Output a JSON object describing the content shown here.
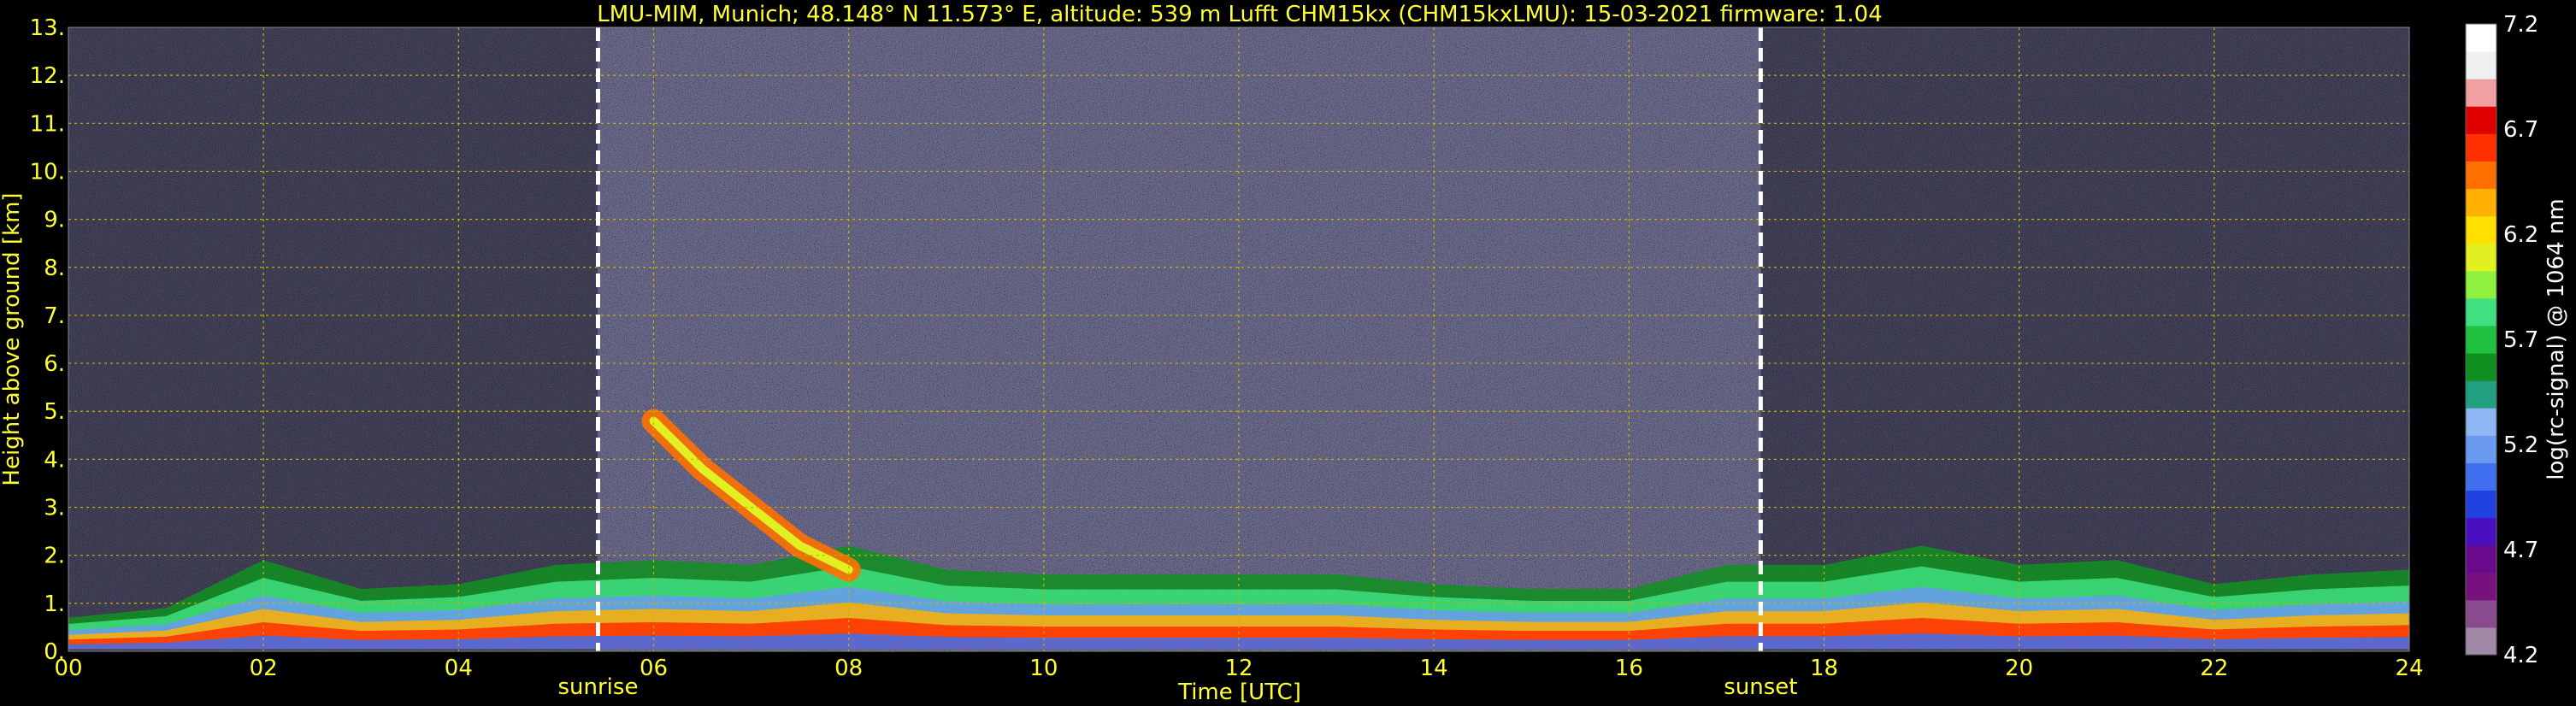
{
  "chart_data": {
    "type": "heatmap",
    "title": "LMU-MIM, Munich; 48.148° N 11.573° E, altitude: 539 m    Lufft CHM15kx (CHM15kxLMU): 15-03-2021    firmware: 1.04",
    "xlabel": "Time [UTC]",
    "ylabel": "Height above ground [km]",
    "colorbar_label": "log(rc-signal) @ 1064 nm",
    "xlim": [
      0,
      24
    ],
    "ylim": [
      0,
      13
    ],
    "x_ticks": [
      "00",
      "02",
      "04",
      "06",
      "08",
      "10",
      "12",
      "14",
      "16",
      "18",
      "20",
      "22",
      "24"
    ],
    "y_ticks": [
      "0.",
      "1.",
      "2.",
      "3.",
      "4.",
      "5.",
      "6.",
      "7.",
      "8.",
      "9.",
      "10.",
      "11.",
      "12.",
      "13."
    ],
    "colorbar_ticks": [
      "4.2",
      "4.7",
      "5.2",
      "5.7",
      "6.2",
      "6.7",
      "7.2"
    ],
    "colorbar_range": [
      4.2,
      7.2
    ],
    "grid": true,
    "annotations": [
      {
        "label": "sunrise",
        "x": 5.43
      },
      {
        "label": "sunset",
        "x": 17.35
      }
    ],
    "colormap": [
      "#a08aa8",
      "#8a4a8e",
      "#76117e",
      "#6a0a8e",
      "#4a10c0",
      "#2040e0",
      "#4070f0",
      "#6a9af0",
      "#8fb6f5",
      "#20a080",
      "#109020",
      "#20c040",
      "#40e080",
      "#90f040",
      "#e0f020",
      "#ffe000",
      "#ffb000",
      "#ff7000",
      "#ff3000",
      "#e00000",
      "#f0a0a0",
      "#f0f0f0",
      "#ffffff"
    ],
    "layers": {
      "boundary_layer": [
        {
          "x": 0.0,
          "top": 0.7,
          "bottom": 0.05
        },
        {
          "x": 1.0,
          "top": 0.9,
          "bottom": 0.05
        },
        {
          "x": 2.0,
          "top": 1.9,
          "bottom": 0.05
        },
        {
          "x": 3.0,
          "top": 1.3,
          "bottom": 0.05
        },
        {
          "x": 4.0,
          "top": 1.4,
          "bottom": 0.05
        },
        {
          "x": 5.0,
          "top": 1.8,
          "bottom": 0.05
        },
        {
          "x": 6.0,
          "top": 1.9,
          "bottom": 0.05
        },
        {
          "x": 7.0,
          "top": 1.8,
          "bottom": 0.05
        },
        {
          "x": 8.0,
          "top": 2.2,
          "bottom": 0.05
        },
        {
          "x": 9.0,
          "top": 1.7,
          "bottom": 0.05
        },
        {
          "x": 10.0,
          "top": 1.6,
          "bottom": 0.05
        },
        {
          "x": 11.0,
          "top": 1.6,
          "bottom": 0.05
        },
        {
          "x": 12.0,
          "top": 1.6,
          "bottom": 0.05
        },
        {
          "x": 13.0,
          "top": 1.6,
          "bottom": 0.05
        },
        {
          "x": 14.0,
          "top": 1.4,
          "bottom": 0.05
        },
        {
          "x": 15.0,
          "top": 1.3,
          "bottom": 0.05
        },
        {
          "x": 16.0,
          "top": 1.3,
          "bottom": 0.05
        },
        {
          "x": 17.0,
          "top": 1.8,
          "bottom": 0.05
        },
        {
          "x": 18.0,
          "top": 1.8,
          "bottom": 0.05
        },
        {
          "x": 19.0,
          "top": 2.2,
          "bottom": 0.05
        },
        {
          "x": 20.0,
          "top": 1.8,
          "bottom": 0.05
        },
        {
          "x": 21.0,
          "top": 1.9,
          "bottom": 0.05
        },
        {
          "x": 22.0,
          "top": 1.4,
          "bottom": 0.05
        },
        {
          "x": 23.0,
          "top": 1.6,
          "bottom": 0.05
        },
        {
          "x": 24.0,
          "top": 1.7,
          "bottom": 0.05
        }
      ],
      "elevated_aerosol": [
        {
          "x": 6.0,
          "y": 4.8
        },
        {
          "x": 6.5,
          "y": 3.8
        },
        {
          "x": 7.0,
          "y": 3.0
        },
        {
          "x": 7.5,
          "y": 2.2
        },
        {
          "x": 8.0,
          "y": 1.7
        }
      ]
    }
  }
}
